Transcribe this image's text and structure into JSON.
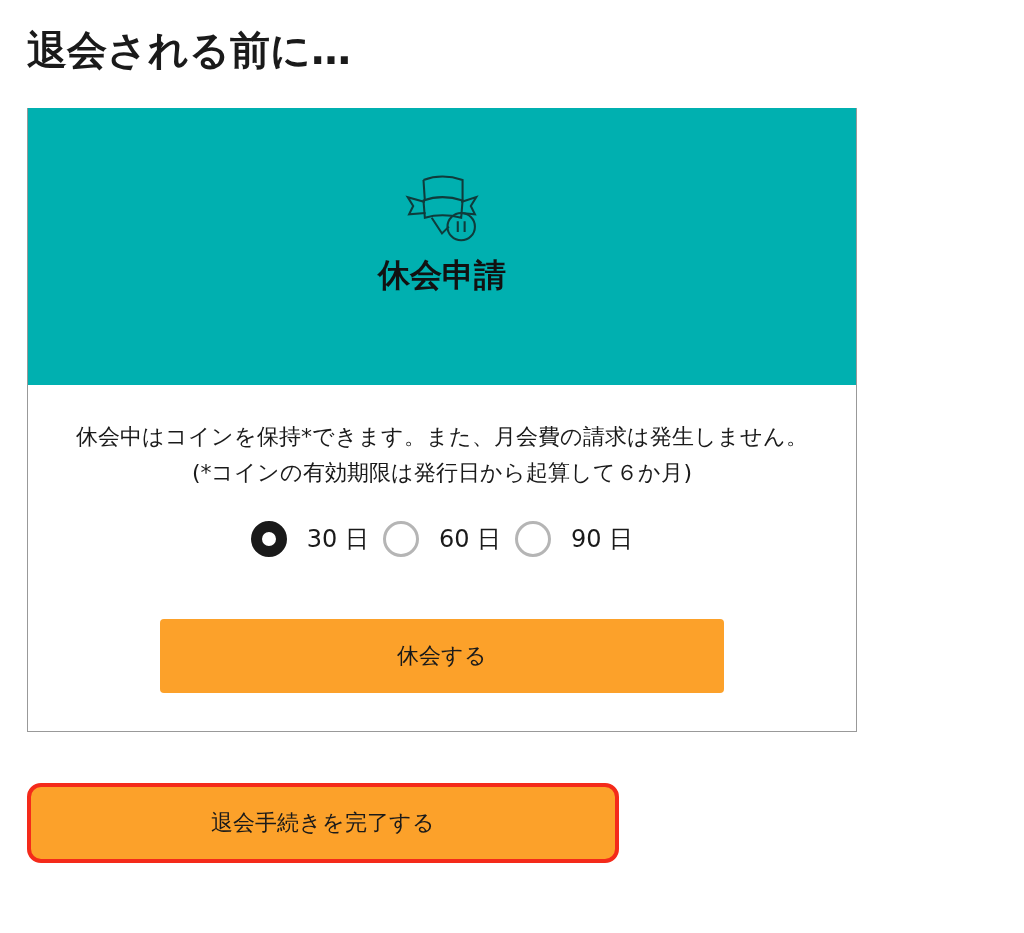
{
  "title": "退会される前に…",
  "card": {
    "heading": "休会申請",
    "description": "休会中はコインを保持*できます。また、月会費の請求は発生しません。(*コインの有効期限は発行日から起算して６か月)",
    "options": [
      {
        "label": "30 日",
        "selected": true
      },
      {
        "label": "60 日",
        "selected": false
      },
      {
        "label": "90 日",
        "selected": false
      }
    ],
    "button": "休会する"
  },
  "complete_button": "退会手続きを完了する"
}
